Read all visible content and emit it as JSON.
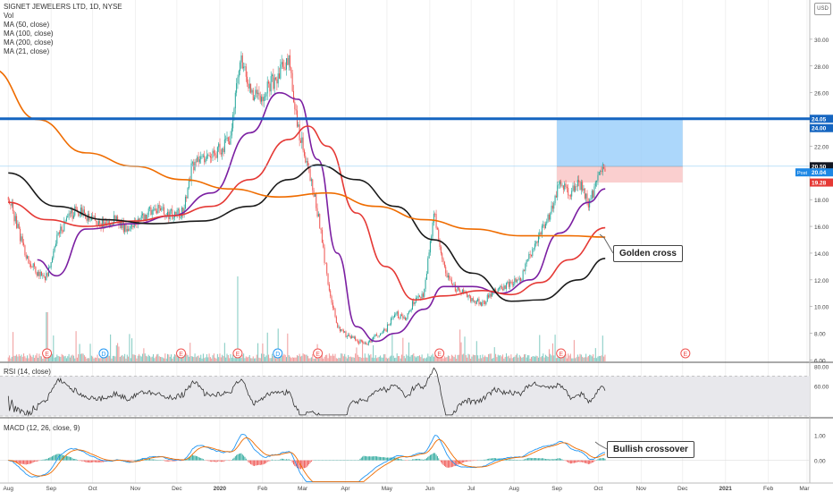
{
  "header": {
    "title": "SIGNET JEWELERS LTD, 1D, NYSE",
    "currency": "USD",
    "indicators": [
      "Vol",
      "MA (50, close)",
      "MA (100, close)",
      "MA (200, close)",
      "MA (21, close)"
    ]
  },
  "panels": {
    "rsi_label": "RSI (14, close)",
    "macd_label": "MACD (12, 26, close, 9)"
  },
  "annotations": {
    "golden_cross": "Golden cross",
    "bullish_crossover": "Bullish crossover"
  },
  "price_tags": {
    "resistance": "24.05",
    "resistance_alt": "24.00",
    "last": "20.50",
    "post_label": "Post",
    "post": "20.04",
    "stop": "19.28"
  },
  "chart_data": [
    {
      "type": "candlestick",
      "title": "SIGNET JEWELERS LTD, 1D, NYSE",
      "y_axis_ticks": [
        "30.00",
        "28.00",
        "26.00",
        "24.00",
        "22.00",
        "20.00",
        "18.00",
        "16.00",
        "14.00",
        "12.00",
        "10.00",
        "8.00",
        "6.00"
      ],
      "ylim": [
        5.9,
        32.4
      ],
      "x_axis_ticks": [
        "Aug",
        "Sep",
        "Oct",
        "Nov",
        "Dec",
        "2020",
        "Feb",
        "Mar",
        "Apr",
        "May",
        "Jun",
        "Jul",
        "Aug",
        "Sep",
        "Oct",
        "Nov",
        "Dec",
        "2021",
        "Feb",
        "Mar"
      ],
      "close_series": [
        [
          "2019-08-01",
          18.2
        ],
        [
          "2019-08-08",
          15.8
        ],
        [
          "2019-08-15",
          13.5
        ],
        [
          "2019-08-22",
          12.5
        ],
        [
          "2019-08-29",
          12.2
        ],
        [
          "2019-09-05",
          15.0
        ],
        [
          "2019-09-12",
          16.5
        ],
        [
          "2019-09-19",
          17.2
        ],
        [
          "2019-09-26",
          16.8
        ],
        [
          "2019-10-03",
          16.4
        ],
        [
          "2019-10-10",
          16.0
        ],
        [
          "2019-10-17",
          16.6
        ],
        [
          "2019-10-24",
          15.9
        ],
        [
          "2019-10-31",
          16.2
        ],
        [
          "2019-11-07",
          16.8
        ],
        [
          "2019-11-14",
          17.3
        ],
        [
          "2019-11-21",
          17.1
        ],
        [
          "2019-11-28",
          16.8
        ],
        [
          "2019-12-05",
          17.0
        ],
        [
          "2019-12-12",
          20.5
        ],
        [
          "2019-12-19",
          21.0
        ],
        [
          "2019-12-26",
          21.5
        ],
        [
          "2020-01-02",
          21.8
        ],
        [
          "2020-01-09",
          22.5
        ],
        [
          "2020-01-16",
          29.0
        ],
        [
          "2020-01-23",
          26.0
        ],
        [
          "2020-01-30",
          25.5
        ],
        [
          "2020-02-06",
          26.5
        ],
        [
          "2020-02-13",
          27.5
        ],
        [
          "2020-02-20",
          28.5
        ],
        [
          "2020-02-27",
          23.0
        ],
        [
          "2020-03-05",
          20.5
        ],
        [
          "2020-03-12",
          17.0
        ],
        [
          "2020-03-19",
          12.0
        ],
        [
          "2020-03-26",
          8.5
        ],
        [
          "2020-04-02",
          7.8
        ],
        [
          "2020-04-09",
          7.5
        ],
        [
          "2020-04-16",
          7.2
        ],
        [
          "2020-04-23",
          7.8
        ],
        [
          "2020-04-30",
          8.2
        ],
        [
          "2020-05-07",
          9.5
        ],
        [
          "2020-05-14",
          9.0
        ],
        [
          "2020-05-21",
          10.5
        ],
        [
          "2020-05-28",
          11.0
        ],
        [
          "2020-06-04",
          17.0
        ],
        [
          "2020-06-11",
          13.0
        ],
        [
          "2020-06-18",
          11.5
        ],
        [
          "2020-06-25",
          11.0
        ],
        [
          "2020-07-02",
          10.5
        ],
        [
          "2020-07-09",
          10.2
        ],
        [
          "2020-07-16",
          11.0
        ],
        [
          "2020-07-23",
          11.4
        ],
        [
          "2020-07-30",
          11.8
        ],
        [
          "2020-08-06",
          12.0
        ],
        [
          "2020-08-13",
          14.0
        ],
        [
          "2020-08-20",
          15.5
        ],
        [
          "2020-08-27",
          17.0
        ],
        [
          "2020-09-03",
          19.5
        ],
        [
          "2020-09-10",
          18.5
        ],
        [
          "2020-09-17",
          19.2
        ],
        [
          "2020-09-24",
          17.8
        ],
        [
          "2020-10-01",
          19.5
        ],
        [
          "2020-10-06",
          20.5
        ]
      ],
      "series": [
        {
          "name": "MA (21, close)",
          "color": "#7b1fa2",
          "points": [
            [
              "2019-08-22",
              13.5
            ],
            [
              "2019-09-05",
              12.3
            ],
            [
              "2019-09-26",
              15.8
            ],
            [
              "2019-10-31",
              16.2
            ],
            [
              "2019-11-28",
              16.8
            ],
            [
              "2019-12-26",
              18.5
            ],
            [
              "2020-01-23",
              23.0
            ],
            [
              "2020-02-13",
              26.0
            ],
            [
              "2020-02-27",
              25.5
            ],
            [
              "2020-03-12",
              21.0
            ],
            [
              "2020-03-26",
              14.0
            ],
            [
              "2020-04-09",
              8.5
            ],
            [
              "2020-04-23",
              7.4
            ],
            [
              "2020-05-07",
              8.0
            ],
            [
              "2020-05-28",
              9.8
            ],
            [
              "2020-06-11",
              11.5
            ],
            [
              "2020-07-02",
              11.5
            ],
            [
              "2020-07-23",
              11.0
            ],
            [
              "2020-08-13",
              12.0
            ],
            [
              "2020-09-03",
              15.5
            ],
            [
              "2020-09-24",
              17.8
            ],
            [
              "2020-10-06",
              18.8
            ]
          ]
        },
        {
          "name": "MA (50, close)",
          "color": "#e53935",
          "points": [
            [
              "2019-08-01",
              17.8
            ],
            [
              "2019-08-29",
              16.5
            ],
            [
              "2019-09-26",
              16.0
            ],
            [
              "2019-10-31",
              16.4
            ],
            [
              "2019-11-28",
              16.8
            ],
            [
              "2019-12-26",
              17.5
            ],
            [
              "2020-01-23",
              19.5
            ],
            [
              "2020-02-20",
              22.5
            ],
            [
              "2020-03-05",
              23.5
            ],
            [
              "2020-03-19",
              22.0
            ],
            [
              "2020-04-09",
              17.0
            ],
            [
              "2020-04-30",
              13.0
            ],
            [
              "2020-05-21",
              10.5
            ],
            [
              "2020-06-11",
              10.8
            ],
            [
              "2020-07-09",
              11.2
            ],
            [
              "2020-07-30",
              10.9
            ],
            [
              "2020-08-20",
              11.8
            ],
            [
              "2020-09-10",
              13.5
            ],
            [
              "2020-10-06",
              15.9
            ]
          ]
        },
        {
          "name": "MA (100, close)",
          "color": "#1a1a1a",
          "points": [
            [
              "2019-08-01",
              20.0
            ],
            [
              "2019-09-05",
              17.5
            ],
            [
              "2019-10-10",
              16.5
            ],
            [
              "2019-11-14",
              16.2
            ],
            [
              "2019-12-19",
              16.4
            ],
            [
              "2020-01-23",
              17.5
            ],
            [
              "2020-02-20",
              19.5
            ],
            [
              "2020-03-12",
              20.6
            ],
            [
              "2020-04-09",
              19.5
            ],
            [
              "2020-05-07",
              17.5
            ],
            [
              "2020-06-04",
              15.0
            ],
            [
              "2020-07-02",
              12.5
            ],
            [
              "2020-07-30",
              10.4
            ],
            [
              "2020-08-20",
              10.5
            ],
            [
              "2020-09-17",
              12.0
            ],
            [
              "2020-10-06",
              13.6
            ]
          ]
        },
        {
          "name": "MA (200, close)",
          "color": "#ef6c00",
          "points": [
            [
              "2019-07-20",
              27.8
            ],
            [
              "2019-08-22",
              24.0
            ],
            [
              "2019-09-26",
              21.5
            ],
            [
              "2019-10-31",
              20.5
            ],
            [
              "2019-12-05",
              19.5
            ],
            [
              "2020-01-09",
              18.8
            ],
            [
              "2020-02-13",
              18.2
            ],
            [
              "2020-03-19",
              18.5
            ],
            [
              "2020-04-23",
              17.5
            ],
            [
              "2020-05-28",
              16.5
            ],
            [
              "2020-07-02",
              15.8
            ],
            [
              "2020-08-06",
              15.3
            ],
            [
              "2020-09-10",
              15.3
            ],
            [
              "2020-10-06",
              15.2
            ]
          ]
        }
      ]
    },
    {
      "type": "bar",
      "title": "Vol"
    },
    {
      "type": "line",
      "title": "RSI (14, close)",
      "y_axis_ticks": [
        "80.00",
        "60.00"
      ],
      "ylim": [
        30,
        83
      ]
    },
    {
      "type": "line",
      "title": "MACD (12, 26, close, 9)",
      "y_axis_ticks": [
        "1.00",
        "0.00"
      ],
      "ylim": [
        -0.9,
        1.65
      ]
    }
  ]
}
